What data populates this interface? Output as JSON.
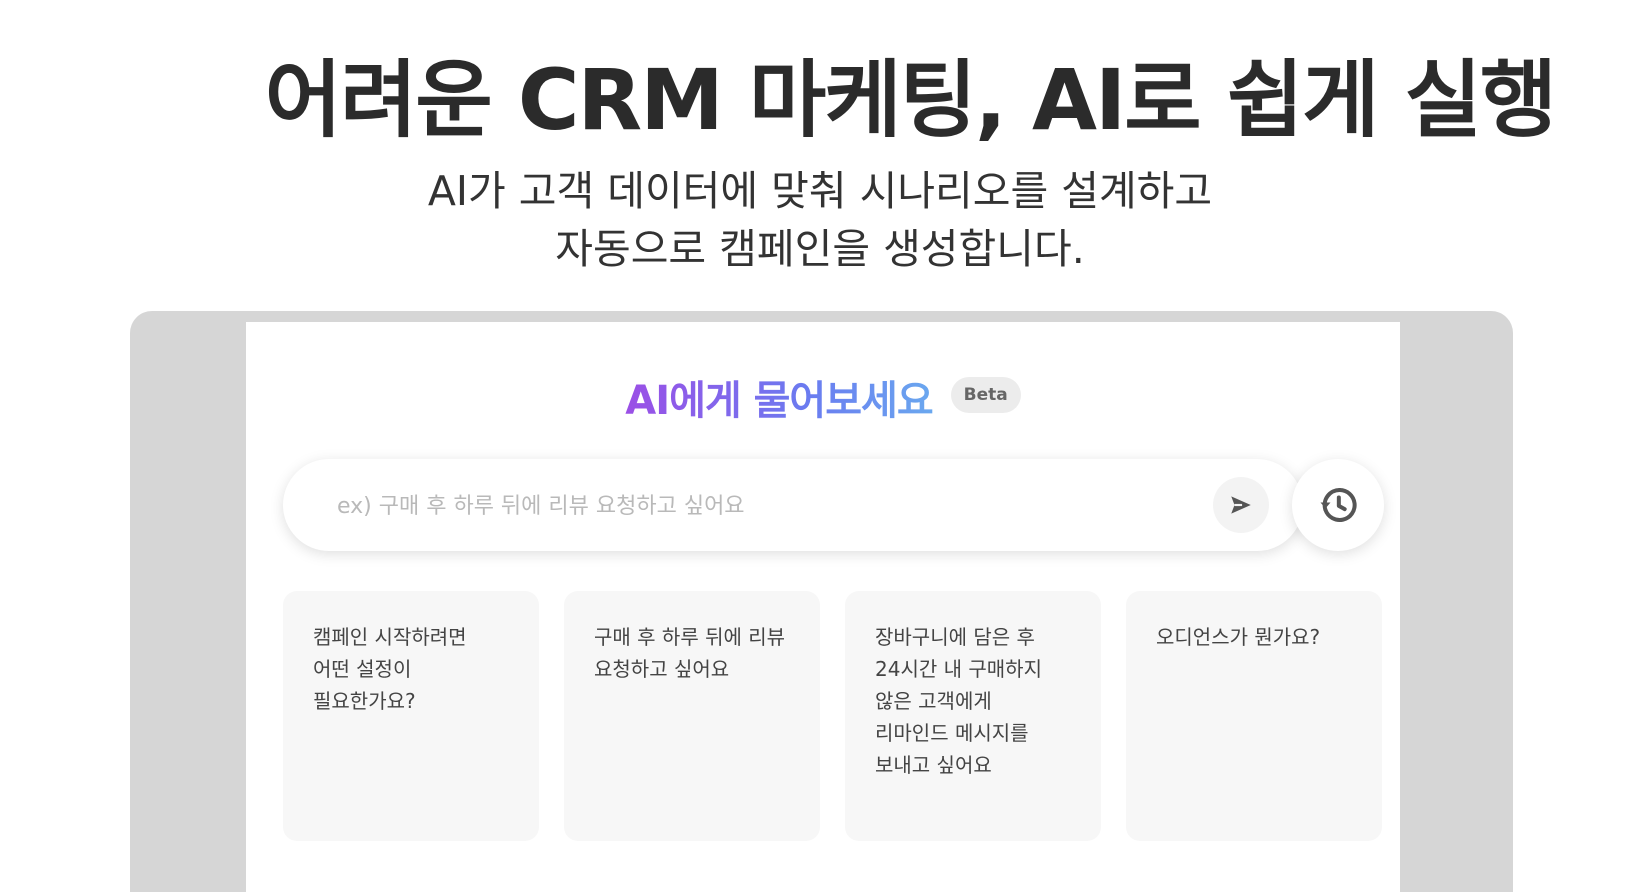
{
  "hero": {
    "title": "어려운 CRM 마케팅, AI로 쉽게 실행",
    "subtitle_line1": "AI가 고객 데이터에 맞춰 시나리오를 설계하고",
    "subtitle_line2": "자동으로 캠페인을 생성합니다."
  },
  "assistant": {
    "title": "AI에게 물어보세요",
    "badge": "Beta",
    "search_placeholder": "ex) 구매 후 하루 뒤에 리뷰 요청하고 싶어요",
    "search_value": "",
    "send_icon": "send-icon",
    "history_icon": "history-icon",
    "suggestions": [
      {
        "label": "캠페인 시작하려면 어떤 설정이 필요한가요?"
      },
      {
        "label": "구매 후 하루 뒤에 리뷰 요청하고 싶어요"
      },
      {
        "label": "장바구니에 담은 후 24시간 내 구매하지 않은 고객에게 리마인드 메시지를 보내고 싶어요"
      },
      {
        "label": "오디언스가 뭔가요?"
      }
    ]
  },
  "colors": {
    "title_gradient_start": "#9b4fe6",
    "title_gradient_end": "#6aa8ef",
    "frame": "#d6d6d6",
    "card_bg": "#f7f7f7"
  }
}
